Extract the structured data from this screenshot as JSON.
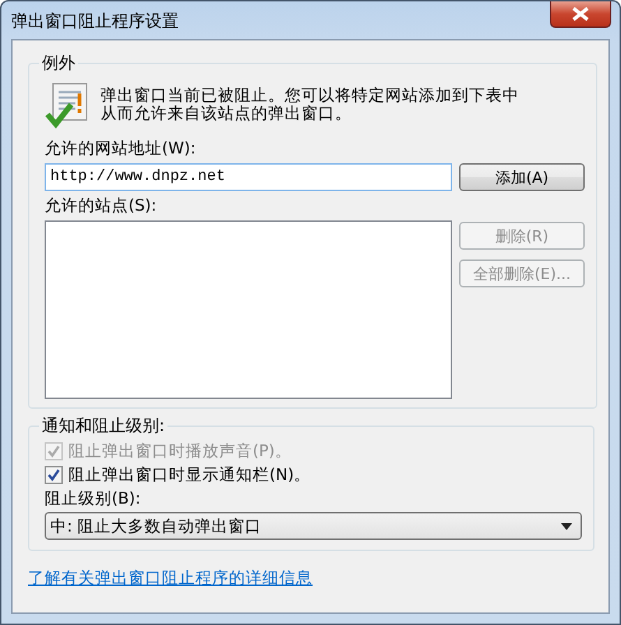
{
  "window": {
    "title": "弹出窗口阻止程序设置"
  },
  "exceptions": {
    "title": "例外",
    "message": "弹出窗口当前已被阻止。您可以将特定网站添加到下表中从而允许来自该站点的弹出窗口。",
    "address_label": "允许的网站地址(W):",
    "address_field": {
      "value": "http://www.dnpz.net"
    },
    "add_button": {
      "label": "添加(A)",
      "disabled": false
    },
    "sites_label": "允许的站点(S):",
    "buttons": [
      {
        "label": "删除(R)",
        "disabled": true
      },
      {
        "label": "全部删除(E)...",
        "disabled": true
      }
    ]
  },
  "notifications": {
    "title": "通知和阻止级别:",
    "options": [
      {
        "label": "阻止弹出窗口时播放声音(P)。",
        "checked": true,
        "disabled": true
      },
      {
        "label": "阻止弹出窗口时显示通知栏(N)。",
        "checked": true,
        "disabled": false
      }
    ],
    "level_label": "阻止级别(B):",
    "level_select": {
      "value": "中: 阻止大多数自动弹出窗口"
    }
  },
  "link": "了解有关弹出窗口阻止程序的详细信息"
}
